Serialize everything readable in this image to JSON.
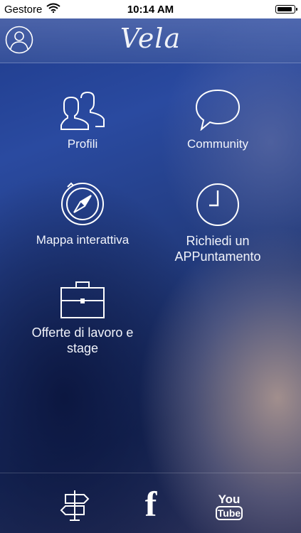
{
  "status_bar": {
    "carrier": "Gestore",
    "time": "10:14 AM"
  },
  "nav": {
    "title": "Vela"
  },
  "menu": [
    {
      "label": "Profili"
    },
    {
      "label": "Community"
    },
    {
      "label": "Mappa interattiva"
    },
    {
      "label": "Richiedi un APPuntamento"
    },
    {
      "label": "Offerte di lavoro e stage"
    }
  ],
  "footer": {
    "facebook_glyph": "f",
    "youtube_top": "You",
    "youtube_bottom": "Tube"
  },
  "colors": {
    "status_bar": "#ffffff",
    "background_top": "#1e3a8a",
    "background_bottom": "#2b2f55"
  }
}
